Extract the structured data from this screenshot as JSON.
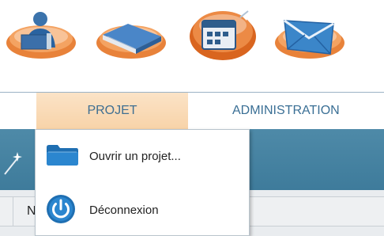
{
  "icons": [
    {
      "name": "user-icon",
      "color": "#2f6fa8"
    },
    {
      "name": "book-icon",
      "color": "#3a6fb0"
    },
    {
      "name": "calendar-icon",
      "color": "#2e5d8c"
    },
    {
      "name": "mail-icon",
      "color": "#3b86c9"
    }
  ],
  "menu": {
    "projet": "PROJET",
    "administration": "ADMINISTRATION"
  },
  "dropdown": {
    "open_project": "Ouvrir un projet...",
    "logout": "Déconnexion"
  },
  "grid": {
    "partial_header": "N"
  },
  "colors": {
    "toolbar": "#4581a1",
    "menu_text": "#3a6f95",
    "menu_active_bg": "#f9d9b4",
    "icon_blob": "#e57a2c"
  }
}
